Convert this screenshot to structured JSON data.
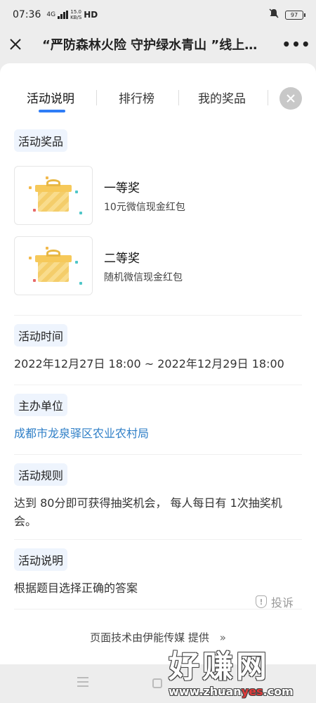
{
  "status_bar": {
    "time": "07:36",
    "network": "4G",
    "speed_value": "15.0",
    "speed_unit": "KB/S",
    "hd": "HD",
    "battery": "97"
  },
  "navbar": {
    "close_icon": "close-icon",
    "title": "“严防森林火险 守护绿水青山 ”线上…",
    "more_label": "•••"
  },
  "tabs": [
    {
      "label": "活动说明",
      "active": true
    },
    {
      "label": "排行榜",
      "active": false
    },
    {
      "label": "我的奖品",
      "active": false
    }
  ],
  "tabs_close_icon": "close-circle-icon",
  "prizes": {
    "heading": "活动奖品",
    "items": [
      {
        "name": "一等奖",
        "desc": "10元微信现金红包",
        "icon": "gift-icon"
      },
      {
        "name": "二等奖",
        "desc": "随机微信现金红包",
        "icon": "gift-icon"
      }
    ]
  },
  "time_section": {
    "heading": "活动时间",
    "value": "2022年12月27日 18:00 ~ 2022年12月29日 18:00"
  },
  "organizer": {
    "heading": "主办单位",
    "value": "成都市龙泉驿区农业农村局"
  },
  "rules": {
    "heading": "活动规则",
    "value": "达到 80分即可获得抽奖机会， 每人每日有 1次抽奖机会。"
  },
  "description": {
    "heading": "活动说明",
    "value": "根据题目选择正确的答案"
  },
  "report": {
    "icon": "shield-alert-icon",
    "icon_glyph": "!",
    "label": "投诉"
  },
  "footer": {
    "label": "页面技术由伊能传媒 提供",
    "chevron": "»"
  },
  "watermark": {
    "main": "好赚网",
    "url_a": "www.zhuan",
    "url_b": "yes",
    "url_c": ".com"
  },
  "colors": {
    "accent": "#2f7df6",
    "link": "#2f7fc7",
    "chip_bg": "#eef4fd"
  }
}
